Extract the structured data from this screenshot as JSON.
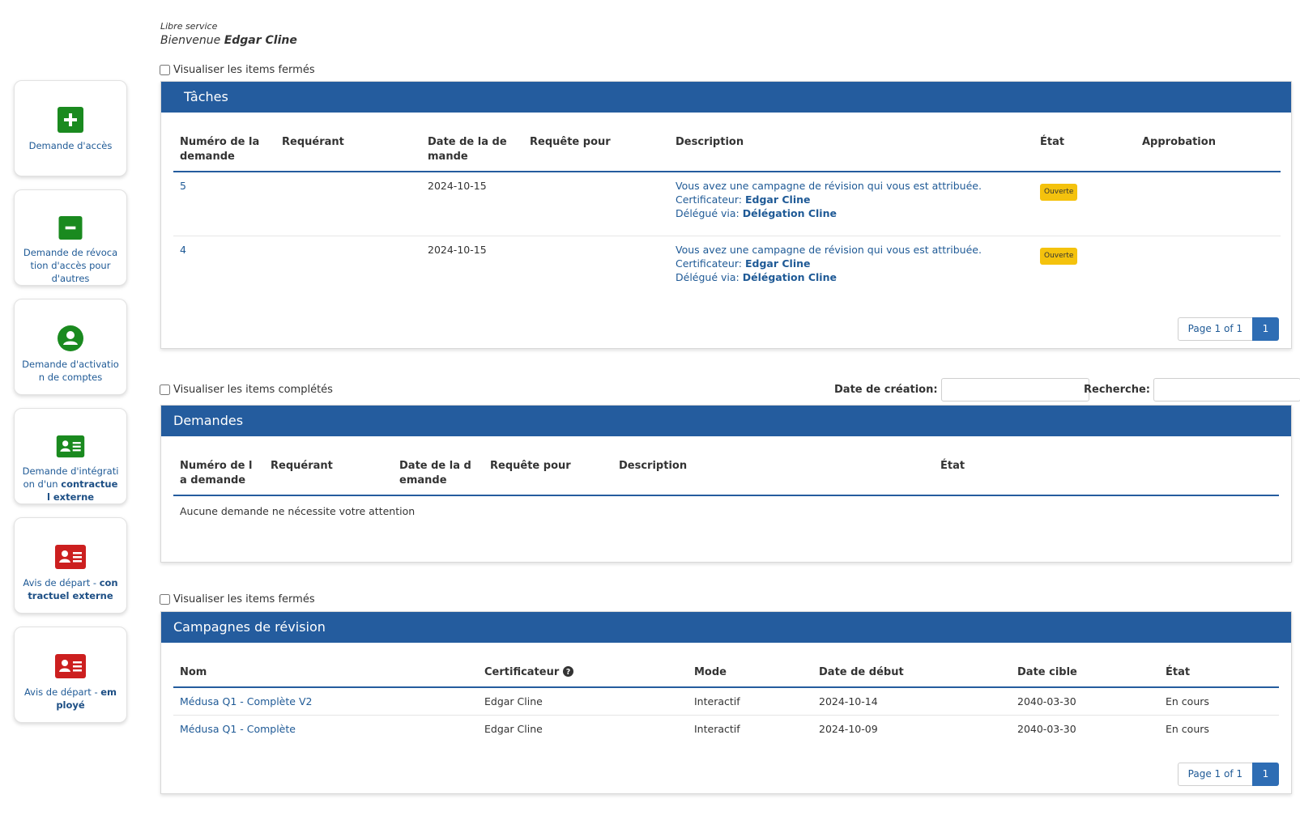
{
  "header": {
    "subtitle": "Libre service",
    "welcome_prefix": "Bienvenue",
    "user_name": "Edgar Cline"
  },
  "sidebar": {
    "items": [
      {
        "label_plain": "Demande d'accès",
        "label_bold": "",
        "icon": "plus-icon",
        "color": "#1a8a1f"
      },
      {
        "label_plain": "Demande de révocation d'accès pour d'autres",
        "label_bold": "",
        "icon": "minus-icon",
        "color": "#1a8a1f"
      },
      {
        "label_plain": "Demande d'activation de comptes",
        "label_bold": "",
        "icon": "user-icon",
        "color": "#1a8a1f"
      },
      {
        "label_plain": "Demande d'intégration d'un ",
        "label_bold": "contractuel externe",
        "icon": "id-card-icon",
        "color": "#1a8a1f"
      },
      {
        "label_plain": "Avis de départ - ",
        "label_bold": "contractuel externe",
        "icon": "id-card-icon",
        "color": "#cc1f1f"
      },
      {
        "label_plain": "Avis de départ - ",
        "label_bold": "employé",
        "icon": "id-card-icon",
        "color": "#cc1f1f"
      }
    ]
  },
  "tasks": {
    "show_closed_label": "Visualiser les items fermés",
    "title": "Tâches",
    "columns": [
      "Numéro de la demande",
      "Requérant",
      "Date de la demande",
      "Requête pour",
      "Description",
      "État",
      "Approbation"
    ],
    "rows": [
      {
        "id": "5",
        "requester": "",
        "date": "2024-10-15",
        "for": "",
        "desc_line1": "Vous avez une campagne de révision qui vous est attribuée.",
        "cert_label": "Certificateur:",
        "cert_name": "Edgar Cline",
        "deleg_label": "Délégué via:",
        "deleg_name": "Délégation Cline",
        "state": "Ouverte",
        "approval": ""
      },
      {
        "id": "4",
        "requester": "",
        "date": "2024-10-15",
        "for": "",
        "desc_line1": "Vous avez une campagne de révision qui vous est attribuée.",
        "cert_label": "Certificateur:",
        "cert_name": "Edgar Cline",
        "deleg_label": "Délégué via:",
        "deleg_name": "Délégation Cline",
        "state": "Ouverte",
        "approval": ""
      }
    ],
    "pager": {
      "info": "Page 1 of 1",
      "current": "1"
    }
  },
  "requests": {
    "show_completed_label": "Visualiser les items complétés",
    "date_filter_label": "Date de création:",
    "search_label": "Recherche:",
    "title": "Demandes",
    "columns": [
      "Numéro de la demande",
      "Requérant",
      "Date de la demande",
      "Requête pour",
      "Description",
      "État"
    ],
    "empty_text": "Aucune demande ne nécessite votre attention"
  },
  "campaigns": {
    "show_closed_label": "Visualiser les items fermés",
    "title": "Campagnes de révision",
    "columns": [
      "Nom",
      "Certificateur",
      "Mode",
      "Date de début",
      "Date cible",
      "État"
    ],
    "rows": [
      {
        "name": "Médusa Q1 - Complète V2",
        "certifier": "Edgar Cline",
        "mode": "Interactif",
        "start": "2024-10-14",
        "target": "2040-03-30",
        "state": "En cours"
      },
      {
        "name": "Médusa Q1 - Complète",
        "certifier": "Edgar Cline",
        "mode": "Interactif",
        "start": "2024-10-09",
        "target": "2040-03-30",
        "state": "En cours"
      }
    ],
    "pager": {
      "info": "Page 1 of 1",
      "current": "1"
    }
  },
  "colors": {
    "header_blue": "#245c9e",
    "link_blue": "#1f5a96",
    "badge_yellow": "#f4c20d",
    "green": "#1a8a1f",
    "red": "#cc1f1f"
  }
}
